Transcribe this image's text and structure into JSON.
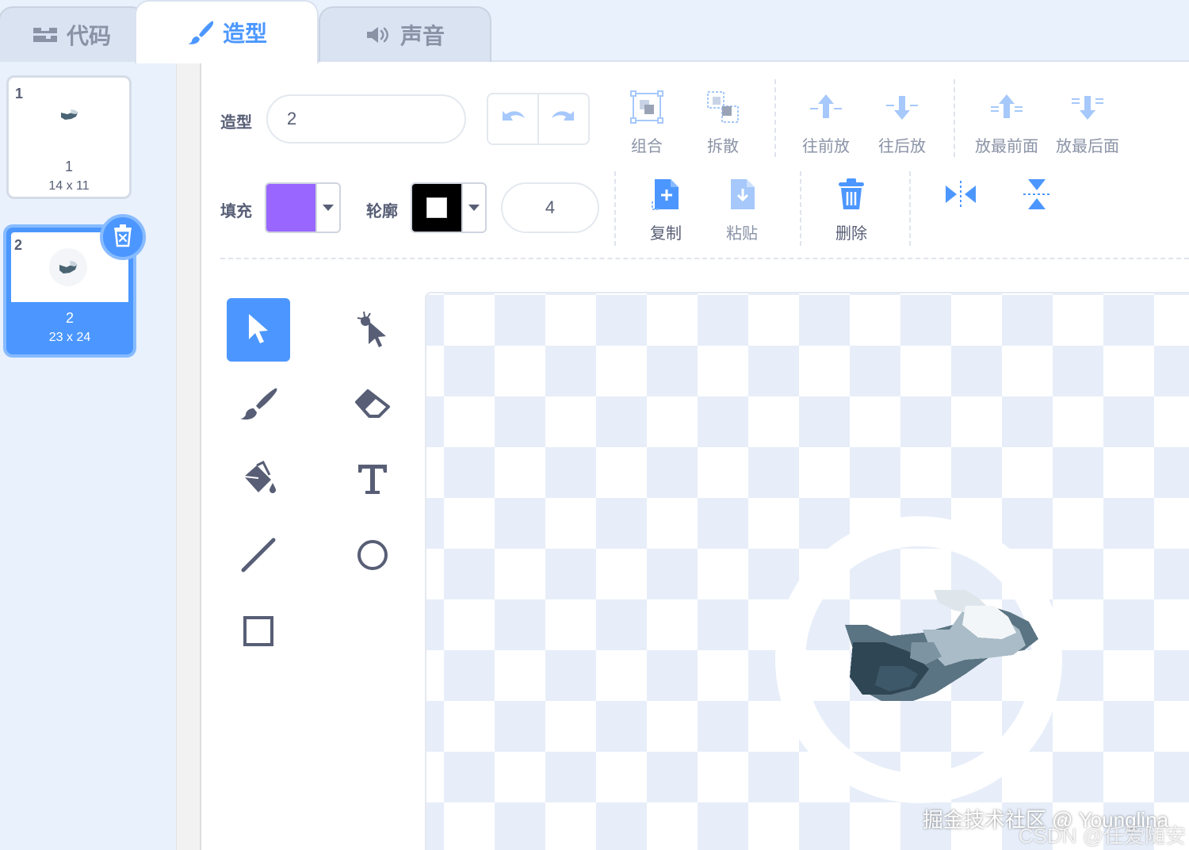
{
  "tabs": [
    {
      "label": "代码",
      "icon": "code-blocks-icon"
    },
    {
      "label": "造型",
      "icon": "paintbrush-icon"
    },
    {
      "label": "声音",
      "icon": "speaker-icon"
    }
  ],
  "costumes": [
    {
      "number": "1",
      "name": "1",
      "size": "14 x 11"
    },
    {
      "number": "2",
      "name": "2",
      "size": "23 x 24"
    }
  ],
  "toolbar": {
    "costume_label": "造型",
    "costume_name": "2",
    "group": "组合",
    "ungroup": "拆散",
    "forward": "往前放",
    "backward": "往后放",
    "front": "放最前面",
    "back": "放最后面",
    "fill_label": "填充",
    "outline_label": "轮廓",
    "outline_size": "4",
    "copy": "复制",
    "paste": "粘贴",
    "delete": "删除"
  },
  "colors": {
    "accent": "#4c97ff",
    "fill": "#9966ff",
    "outline": "#000000",
    "text": "#575e75"
  },
  "tools": [
    "select-tool",
    "reshape-tool",
    "brush-tool",
    "eraser-tool",
    "fill-tool",
    "text-tool",
    "line-tool",
    "circle-tool",
    "rectangle-tool"
  ],
  "watermark": {
    "line1": "掘金技术社区 @ Younglina",
    "line2": "CSDN @任爱随安"
  }
}
